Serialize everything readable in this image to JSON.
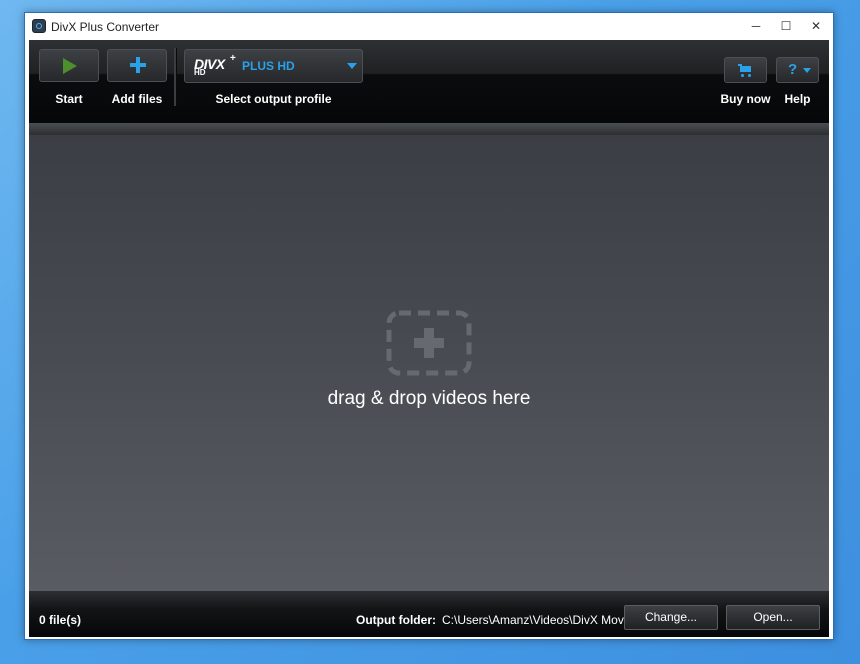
{
  "window": {
    "title": "DivX Plus Converter",
    "controls": {
      "minimize": "─",
      "maximize": "☐",
      "close": "✕"
    }
  },
  "toolbar": {
    "start_label": "Start",
    "add_files_label": "Add files",
    "profile": {
      "logo_text": "DIVX",
      "logo_hd": "HD",
      "logo_plus": "+",
      "selected": "PLUS HD",
      "caption": "Select output profile"
    },
    "buy_now_label": "Buy now",
    "help_label": "Help",
    "help_glyph": "?"
  },
  "drop_area": {
    "message": "drag & drop videos here"
  },
  "status": {
    "file_count": "0 file(s)",
    "output_folder_label": "Output folder:",
    "output_folder_path": "C:\\Users\\Amanz\\Videos\\DivX Movies",
    "change_label": "Change...",
    "open_label": "Open..."
  },
  "colors": {
    "accent": "#2aa1e8",
    "play": "#4c8f2c",
    "toolbar_bg": "#0b0c0d",
    "drop_area": "#474b51"
  },
  "icons": [
    "app-icon",
    "play-icon",
    "plus-icon",
    "dropdown-arrow-icon",
    "cart-icon",
    "help-icon",
    "add-media-icon"
  ]
}
